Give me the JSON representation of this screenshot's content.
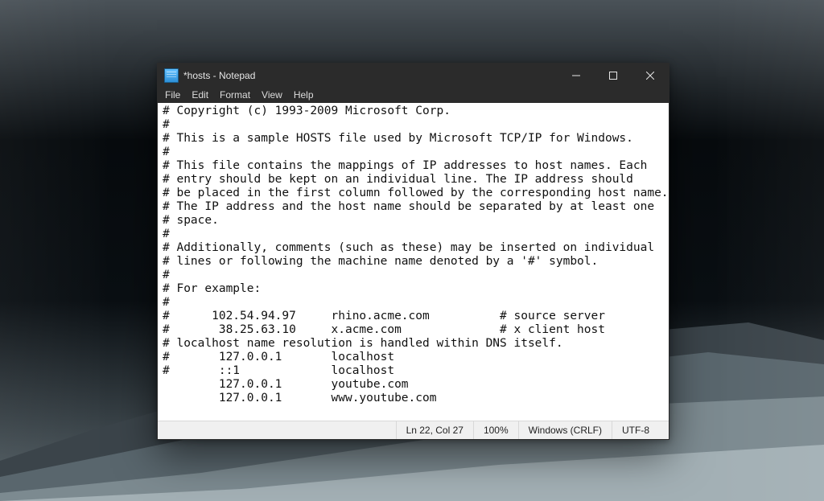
{
  "window": {
    "title": "*hosts - Notepad"
  },
  "menu": {
    "file": "File",
    "edit": "Edit",
    "format": "Format",
    "view": "View",
    "help": "Help"
  },
  "editor": {
    "content": "# Copyright (c) 1993-2009 Microsoft Corp.\n#\n# This is a sample HOSTS file used by Microsoft TCP/IP for Windows.\n#\n# This file contains the mappings of IP addresses to host names. Each\n# entry should be kept on an individual line. The IP address should\n# be placed in the first column followed by the corresponding host name.\n# The IP address and the host name should be separated by at least one\n# space.\n#\n# Additionally, comments (such as these) may be inserted on individual\n# lines or following the machine name denoted by a '#' symbol.\n#\n# For example:\n#\n#      102.54.94.97     rhino.acme.com          # source server\n#       38.25.63.10     x.acme.com              # x client host\n# localhost name resolution is handled within DNS itself.\n#       127.0.0.1       localhost\n#       ::1             localhost\n        127.0.0.1       youtube.com\n        127.0.0.1       www.youtube.com"
  },
  "status": {
    "position": "Ln 22, Col 27",
    "zoom": "100%",
    "line_ending": "Windows (CRLF)",
    "encoding": "UTF-8"
  }
}
